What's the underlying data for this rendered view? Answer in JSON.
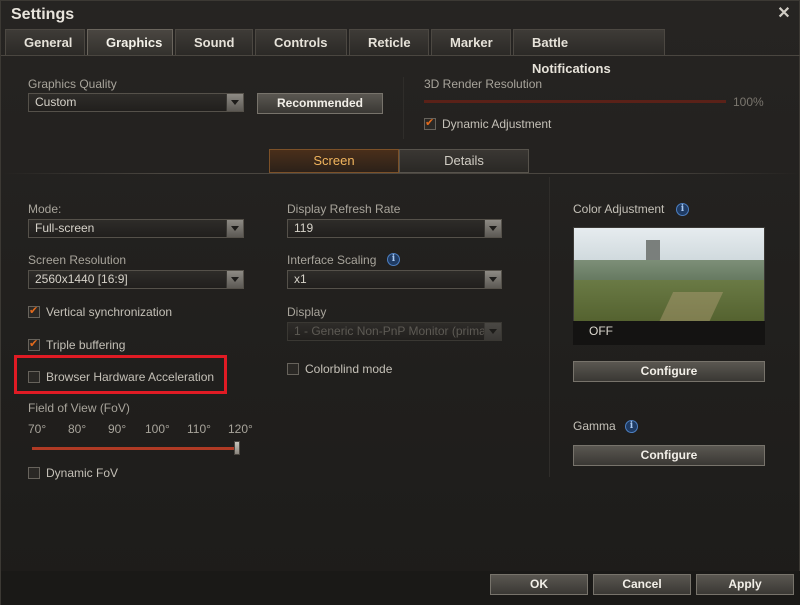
{
  "window": {
    "title": "Settings",
    "close_glyph": "✕"
  },
  "tabs": [
    "General",
    "Graphics",
    "Sound",
    "Controls",
    "Reticle",
    "Marker",
    "Battle Notifications"
  ],
  "active_tab": "Graphics",
  "quality": {
    "label": "Graphics Quality",
    "value": "Custom",
    "recommended_label": "Recommended"
  },
  "render": {
    "label": "3D Render Resolution",
    "value_text": "100%",
    "value": 1.0,
    "dynamic_label": "Dynamic Adjustment",
    "dynamic_checked": true
  },
  "subtabs": [
    "Screen",
    "Details"
  ],
  "active_subtab": "Screen",
  "screen": {
    "mode_label": "Mode:",
    "mode_value": "Full-screen",
    "resolution_label": "Screen Resolution",
    "resolution_value": "2560x1440 [16:9]",
    "vsync_label": "Vertical synchronization",
    "vsync_checked": true,
    "triple_label": "Triple buffering",
    "triple_checked": true,
    "browser_label": "Browser Hardware Acceleration",
    "browser_checked": false,
    "fov_label": "Field of View (FoV)",
    "fov_ticks": [
      "70°",
      "80°",
      "90°",
      "100°",
      "110°",
      "120°"
    ],
    "fov_value": 1.0,
    "dynamic_fov_label": "Dynamic FoV",
    "dynamic_fov_checked": false
  },
  "display": {
    "refresh_label": "Display Refresh Rate",
    "refresh_value": "119",
    "scaling_label": "Interface Scaling",
    "scaling_value": "x1",
    "display_label": "Display",
    "display_value": "1 - Generic Non-PnP Monitor (prima",
    "colorblind_label": "Colorblind mode",
    "colorblind_checked": false
  },
  "color": {
    "label": "Color Adjustment",
    "preview_text": "OFF",
    "configure_label": "Configure"
  },
  "gamma": {
    "label": "Gamma",
    "configure_label": "Configure"
  },
  "footer": {
    "ok": "OK",
    "cancel": "Cancel",
    "apply": "Apply"
  },
  "colors": {
    "accent": "#e36a1c",
    "highlight": "#e01b24",
    "info": "#4d7fc1"
  }
}
